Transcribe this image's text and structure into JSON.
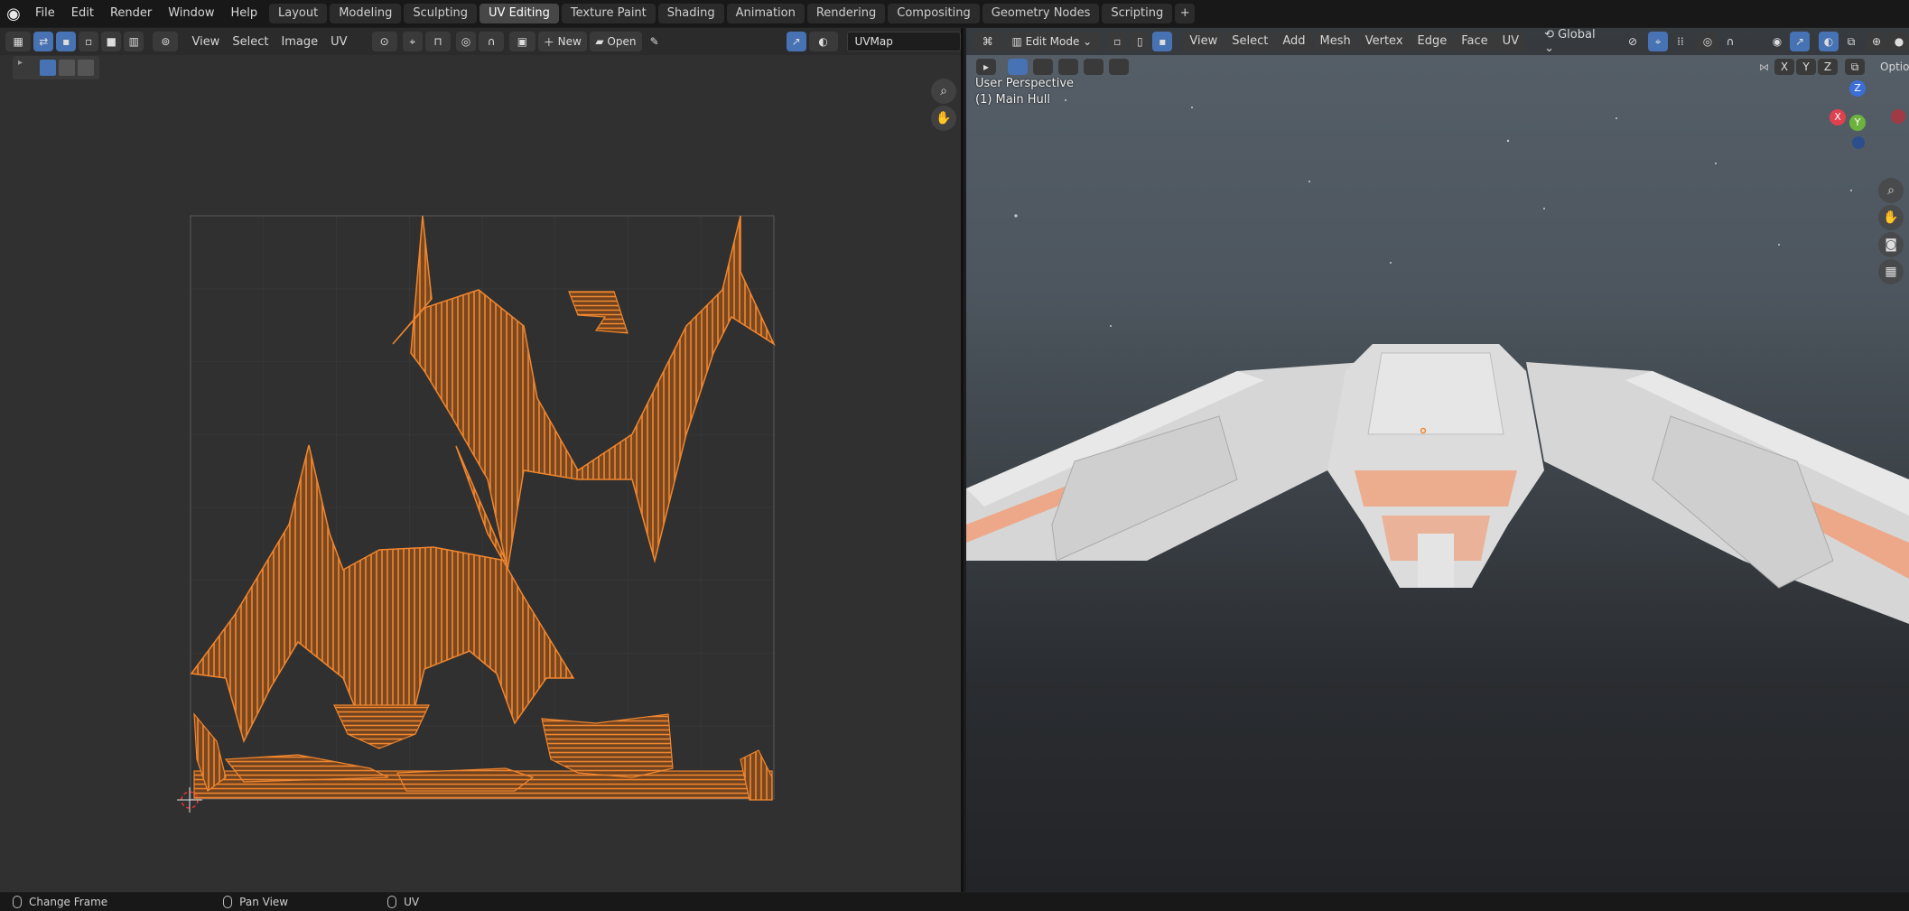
{
  "menus": [
    "File",
    "Edit",
    "Render",
    "Window",
    "Help"
  ],
  "tabs": [
    {
      "label": "Layout",
      "active": false
    },
    {
      "label": "Modeling",
      "active": false
    },
    {
      "label": "Sculpting",
      "active": false
    },
    {
      "label": "UV Editing",
      "active": true
    },
    {
      "label": "Texture Paint",
      "active": false
    },
    {
      "label": "Shading",
      "active": false
    },
    {
      "label": "Animation",
      "active": false
    },
    {
      "label": "Rendering",
      "active": false
    },
    {
      "label": "Compositing",
      "active": false
    },
    {
      "label": "Geometry Nodes",
      "active": false
    },
    {
      "label": "Scripting",
      "active": false
    }
  ],
  "uv_editor": {
    "menus": [
      "View",
      "Select",
      "Image",
      "UV"
    ],
    "new_label": "New",
    "open_label": "Open",
    "uvmap_value": "UVMap"
  },
  "viewport": {
    "mode": "Edit Mode",
    "menus": [
      "View",
      "Select",
      "Add",
      "Mesh",
      "Vertex",
      "Edge",
      "Face",
      "UV"
    ],
    "orientation": "Global",
    "options_label": "Options",
    "perspective_label": "User Perspective",
    "object_label": "(1) Main Hull",
    "axis_x": "X",
    "axis_y": "Y",
    "axis_z": "Z",
    "mirror_axes": [
      "X",
      "Y",
      "Z"
    ]
  },
  "status": {
    "left": "Change Frame",
    "middle": "Pan View",
    "right": "UV"
  },
  "colors": {
    "uv_orange": "#f0862f",
    "accent_blue": "#4772b3",
    "editor_bg": "#303030"
  }
}
